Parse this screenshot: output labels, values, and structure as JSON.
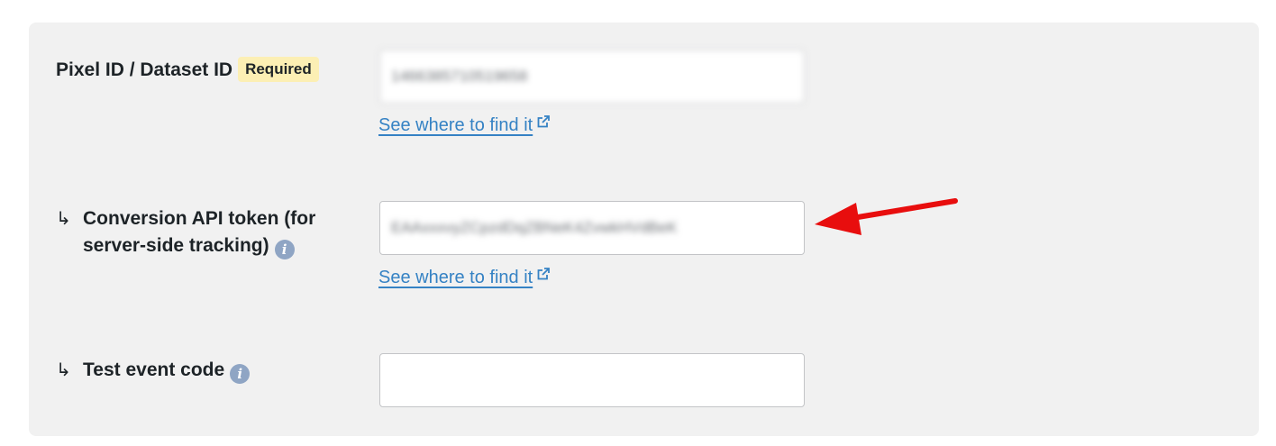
{
  "form": {
    "pixel": {
      "label": "Pixel ID / Dataset ID",
      "badge": "Required",
      "value": "1466385710519658",
      "help_link": "See where to find it"
    },
    "capi": {
      "arrow": "↳",
      "label_line1": "Conversion API token (for",
      "label_line2": "server-side tracking)",
      "value": "EAAxxxvyZCpzdDqZBNeK4ZvwkHVdBeK",
      "help_link": "See where to find it"
    },
    "test_event": {
      "arrow": "↳",
      "label": "Test event code",
      "value": ""
    }
  },
  "colors": {
    "panel_bg": "#f1f1f1",
    "badge_bg": "#fcefb4",
    "link": "#3582c4",
    "info_icon": "#8fa5c4",
    "annotation_arrow": "#e80e0e"
  },
  "icons": {
    "info": "info-icon",
    "external_link": "external-link-icon",
    "annotation": "red-arrow-pointer"
  }
}
